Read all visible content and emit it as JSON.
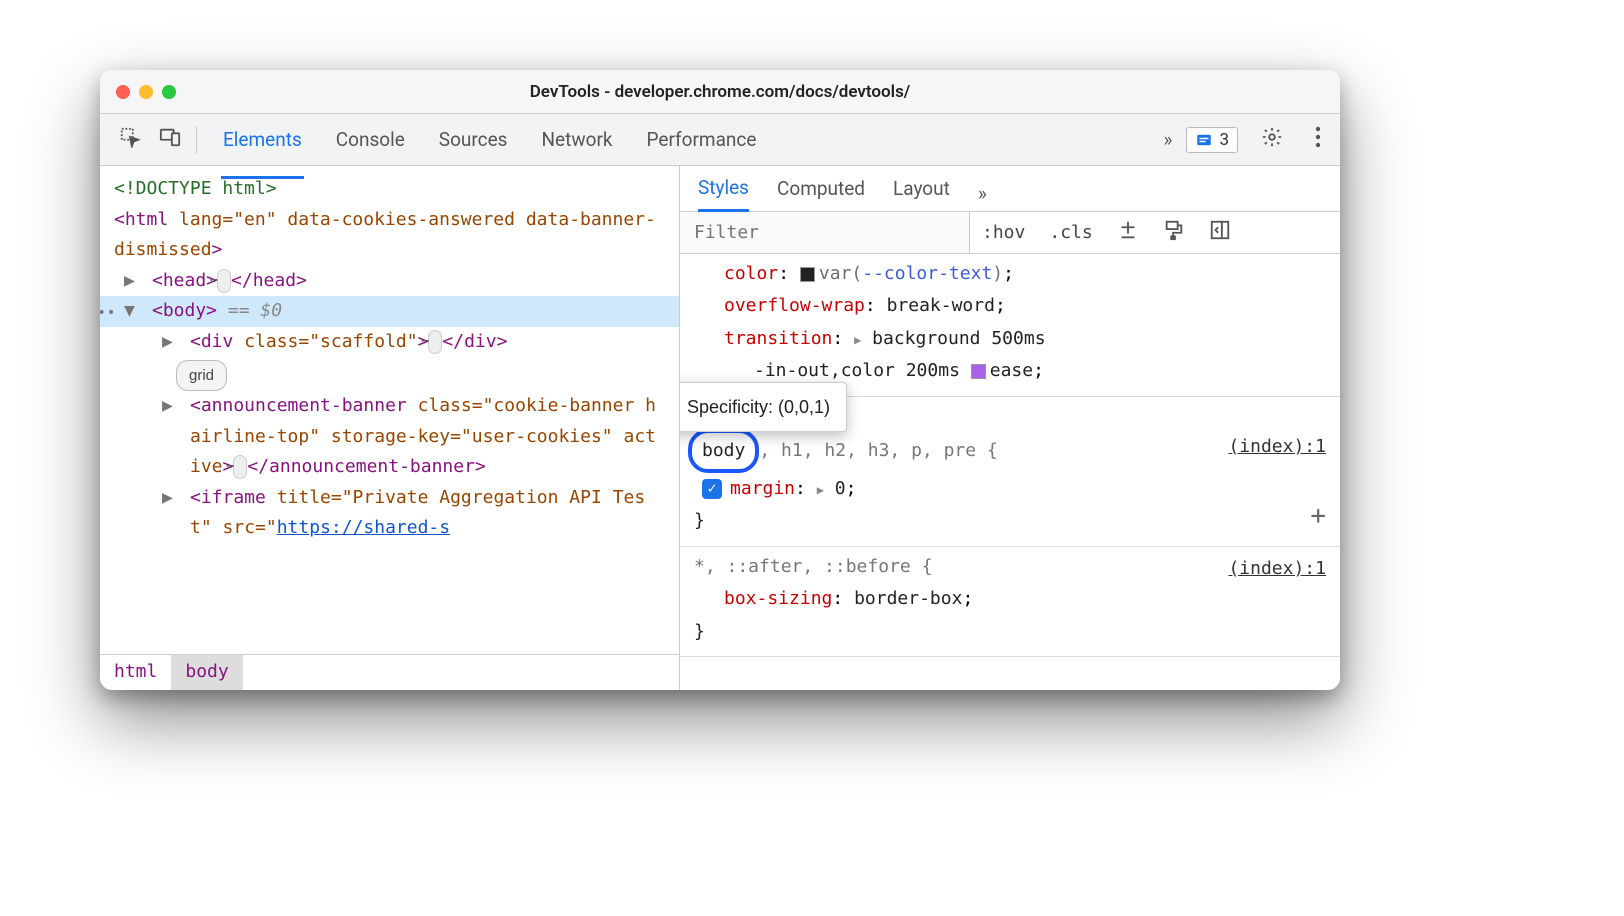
{
  "window": {
    "title": "DevTools - developer.chrome.com/docs/devtools/"
  },
  "toolbar": {
    "tabs": [
      "Elements",
      "Console",
      "Sources",
      "Network",
      "Performance"
    ],
    "activeTab": "Elements",
    "moreLabel": "»",
    "issuesCount": "3"
  },
  "dom": {
    "line0": "<!DOCTYPE html>",
    "line1_open": "<html ",
    "line1_attrs": "lang=\"en\" data-cookies-answered data-banner-dismissed",
    "line1_close": ">",
    "head_open": "<head>",
    "head_close": "</head>",
    "body_open": "<body>",
    "body_eq": " == $0",
    "div_open": "<div ",
    "div_attrs": "class=\"scaffold\"",
    "div_close": ">",
    "div_end": "</div>",
    "grid_badge": "grid",
    "ann_open": "<announcement-banner ",
    "ann_class": "class=\"cookie-banner hairline-top\"",
    "ann_storage": " storage-key=\"user-cookies\"",
    "ann_active": " active",
    "ann_close": ">",
    "ann_end": "</announcement-banner>",
    "iframe_open": "<iframe ",
    "iframe_title": "title=\"Private Aggregation API Test\"",
    "iframe_src_label": " src=\"",
    "iframe_src": "https://shared-s"
  },
  "breadcrumbs": [
    "html",
    "body"
  ],
  "stylesTabs": {
    "tabs": [
      "Styles",
      "Computed",
      "Layout"
    ],
    "active": "Styles",
    "more": "»"
  },
  "filter": {
    "placeholder": "Filter",
    "hov": ":hov",
    "cls": ".cls"
  },
  "rules": {
    "r0": {
      "p0_name": "color",
      "p0_var": "--color-text",
      "p1_name": "overflow-wrap",
      "p1_val": "break-word",
      "p2_name": "transition",
      "p2_val_a": "background 500ms",
      "p2_val_b": "-in-out,color 200ms ",
      "p2_ease": "ease"
    },
    "r1": {
      "selector_matched": "body",
      "selector_rest": ", h1, h2, h3, p, pre {",
      "source": "(index):1",
      "prop_name": "margin",
      "prop_val": "0"
    },
    "r2": {
      "selector": "*, ::after, ::before {",
      "source": "(index):1",
      "prop_name": "box-sizing",
      "prop_val": "border-box"
    }
  },
  "tooltip": {
    "text": "Specificity: (0,0,1)"
  }
}
